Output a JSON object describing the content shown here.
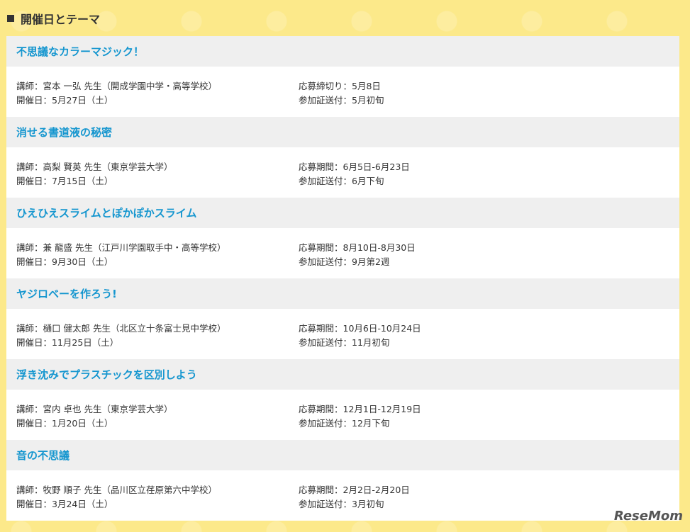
{
  "header": {
    "title": "開催日とテーマ"
  },
  "events": [
    {
      "title": "不思議なカラーマジック！",
      "instructor": "講師：宮本 一弘 先生（開成学園中学・高等学校）",
      "date": "開催日：5月27日（土）",
      "application": "応募締切り：5月8日",
      "pass_sending": "参加証送付：5月初旬"
    },
    {
      "title": "消せる書道液の秘密",
      "instructor": "講師：高梨 賢英 先生（東京学芸大学）",
      "date": "開催日：7月15日（土）",
      "application": "応募期間：6月5日-6月23日",
      "pass_sending": "参加証送付：6月下旬"
    },
    {
      "title": "ひえひえスライムとぽかぽかスライム",
      "instructor": "講師：兼 龍盛 先生（江戸川学園取手中・高等学校）",
      "date": "開催日：9月30日（土）",
      "application": "応募期間：8月10日-8月30日",
      "pass_sending": "参加証送付：9月第2週"
    },
    {
      "title": "ヤジロベーを作ろう!",
      "instructor": "講師：樋口 健太郎 先生（北区立十条富士見中学校）",
      "date": "開催日：11月25日（土）",
      "application": "応募期間：10月6日-10月24日",
      "pass_sending": "参加証送付：11月初旬"
    },
    {
      "title": "浮き沈みでプラスチックを区別しよう",
      "instructor": "講師：宮内 卓也 先生（東京学芸大学）",
      "date": "開催日：1月20日（土）",
      "application": "応募期間：12月1日-12月19日",
      "pass_sending": "参加証送付：12月下旬"
    },
    {
      "title": "音の不思議",
      "instructor": "講師：牧野 順子 先生（品川区立荏原第六中学校）",
      "date": "開催日：3月24日（土）",
      "application": "応募期間：2月2日-2月20日",
      "pass_sending": "参加証送付：3月初旬"
    }
  ],
  "watermark": {
    "logo": "ReseMom"
  }
}
